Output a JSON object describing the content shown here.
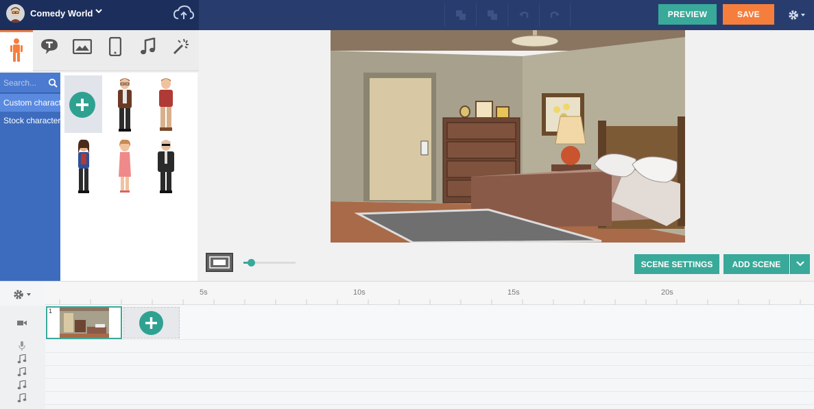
{
  "header": {
    "project_title": "Comedy World",
    "preview_label": "PREVIEW",
    "save_label": "SAVE"
  },
  "asset_tabs": [
    "characters-icon",
    "speech-text-icon",
    "image-icon",
    "phone-icon",
    "music-icon",
    "effects-icon"
  ],
  "sidebar": {
    "search_placeholder": "Search...",
    "items": [
      {
        "label": "Custom characters"
      },
      {
        "label": "Stock characters"
      }
    ]
  },
  "stage": {
    "scene_settings_label": "SCENE SETTINGS",
    "add_scene_label": "ADD SCENE"
  },
  "timeline": {
    "ticks": [
      "5s",
      "10s",
      "15s",
      "20s"
    ],
    "scene_number": "1",
    "tracks": [
      "camera-icon",
      "microphone-icon",
      "music-icon",
      "music-icon",
      "music-icon",
      "music-icon"
    ]
  },
  "colors": {
    "topbar": "#283d6e",
    "accent_teal": "#39a99a",
    "save_orange": "#f57e3d",
    "sidebar_blue": "#3d6cbf"
  }
}
